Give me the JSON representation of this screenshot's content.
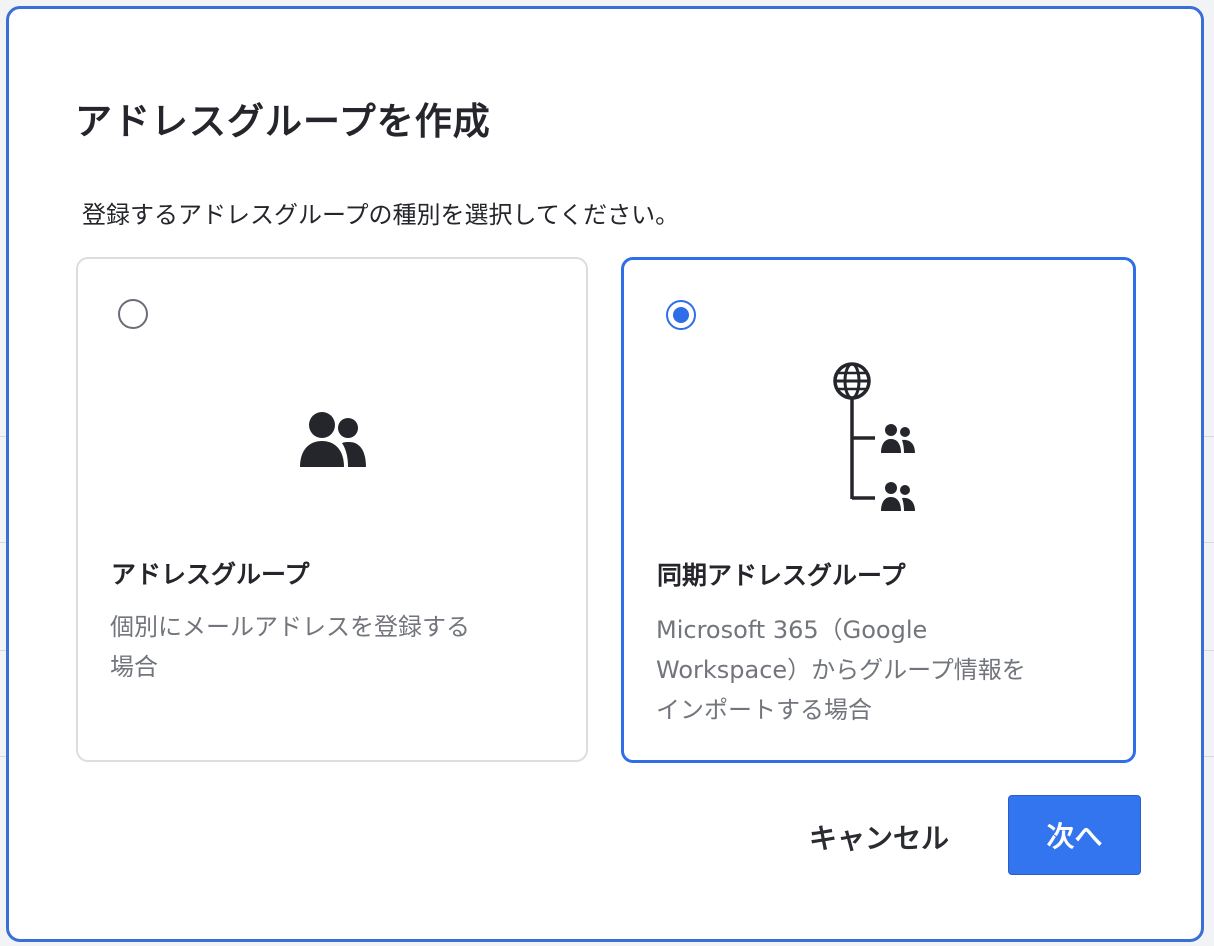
{
  "dialog": {
    "title": "アドレスグループを作成",
    "instruction": "登録するアドレスグループの種別を選択してください。"
  },
  "options": [
    {
      "id": "address-group",
      "selected": false,
      "icon": "people-icon",
      "heading": "アドレスグループ",
      "description_lines": [
        "個別にメールアドレスを登録する",
        "場合"
      ]
    },
    {
      "id": "synced-address-group",
      "selected": true,
      "icon": "globe-tree-people-icon",
      "heading": "同期アドレスグループ",
      "description_lines": [
        "Microsoft 365（Google",
        "Workspace）からグループ情報を",
        "インポートする場合"
      ]
    }
  ],
  "buttons": {
    "cancel_label": "キャンセル",
    "next_label": "次へ"
  },
  "colors": {
    "accent": "#2f6ee8",
    "primary_button": "#3275ef",
    "text_dark": "#24262b",
    "text_muted": "#72757c",
    "card_border": "#dcdde0"
  }
}
